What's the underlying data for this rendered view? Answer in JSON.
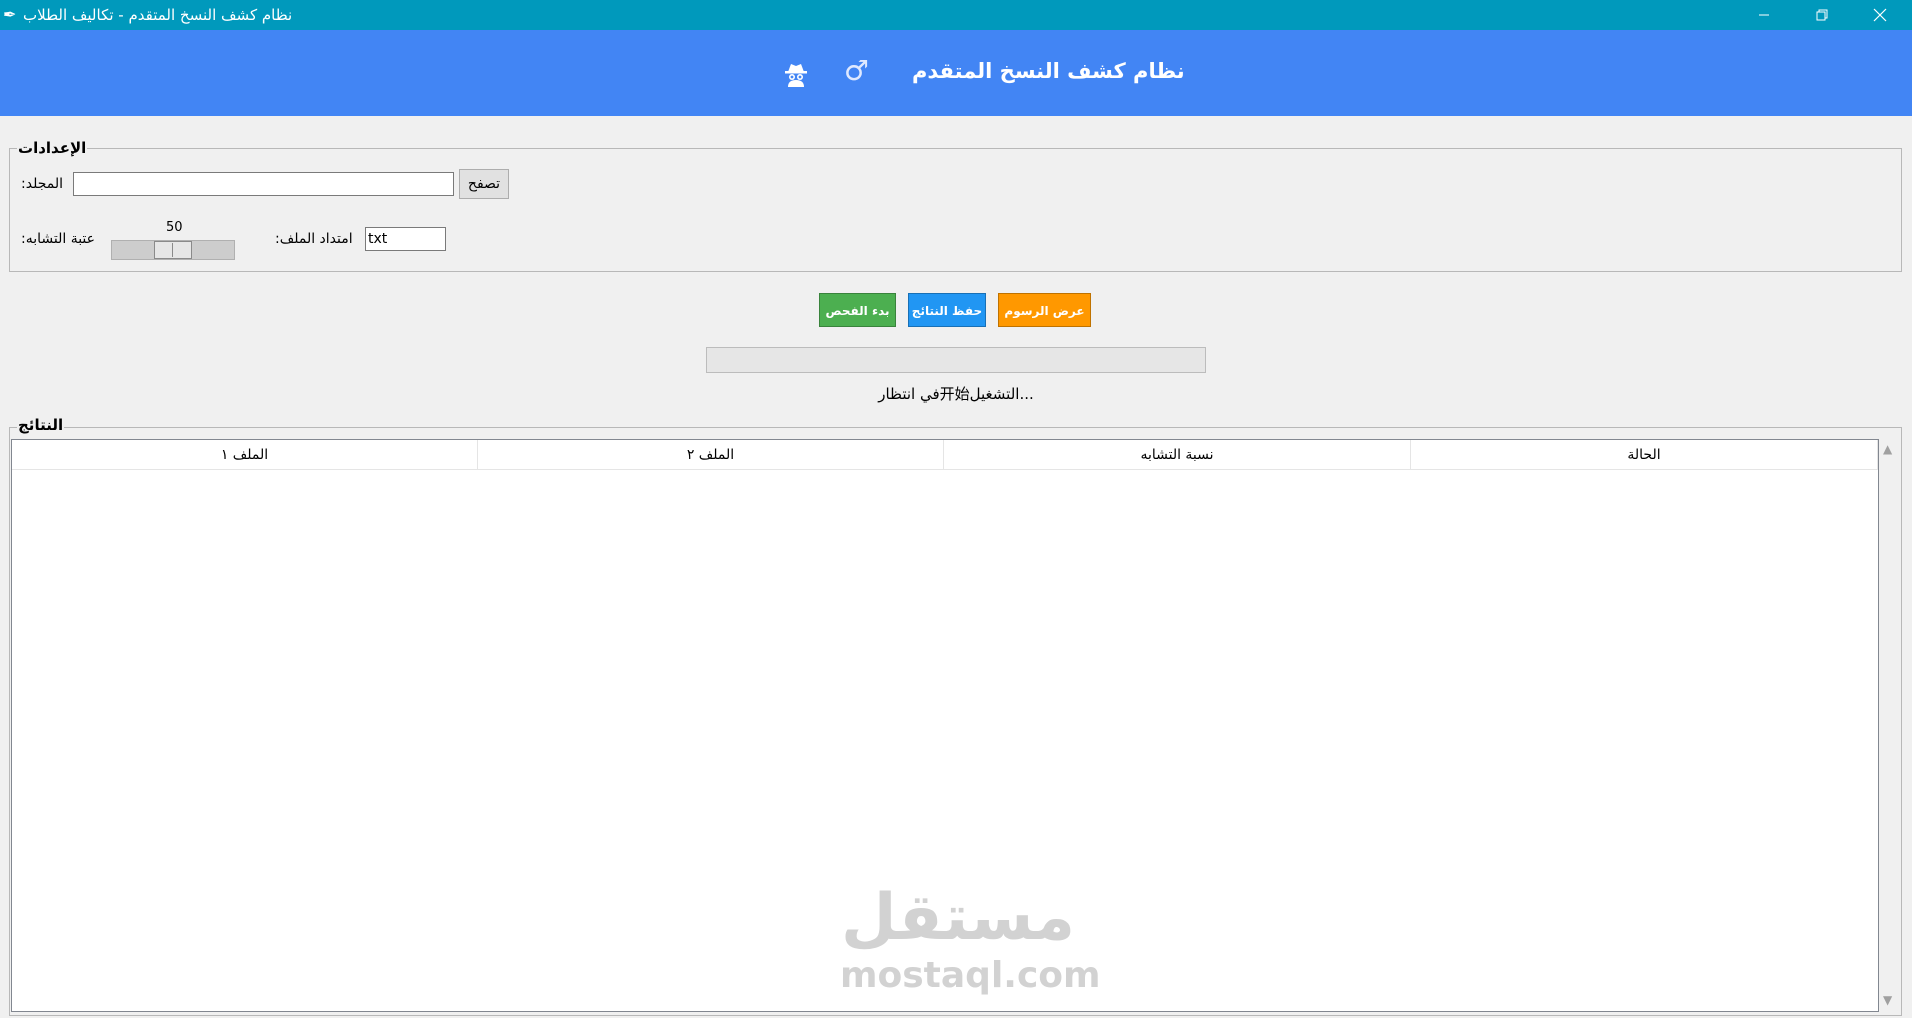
{
  "window": {
    "title": "نظام كشف النسخ المتقدم - تكاليف الطلاب",
    "icon": "feather-icon",
    "controls": [
      "minimize-icon",
      "restore-icon",
      "close-icon"
    ]
  },
  "header": {
    "title": "نظام كشف النسخ المتقدم",
    "male_symbol": "♂",
    "background": "#4285f4"
  },
  "settings": {
    "title": "الإعدادات",
    "folder_label": ":المجلد",
    "folder_value": "",
    "browse_label": "تصفح",
    "threshold_label": ":عتبة التشابه",
    "threshold_value": "50",
    "threshold_min": 0,
    "threshold_max": 100,
    "extension_label": ":امتداد الملف",
    "extension_value": "txt"
  },
  "actions": {
    "start_label": "بدء الفحص",
    "start_color": "#4caf50",
    "save_label": "حفظ النتائج",
    "save_color": "#2196f3",
    "charts_label": "عرض الرسوم",
    "charts_color": "#ff9800"
  },
  "progress": {
    "value": 0
  },
  "status": {
    "text": "في انتظار开始التشغيل..."
  },
  "results": {
    "title": "النتائج",
    "columns": [
      "الملف ١",
      "الملف ٢",
      "نسبة التشابه",
      "الحالة"
    ],
    "rows": []
  },
  "watermark": {
    "logo_text": "مستقل",
    "url_text": "mostaql.com"
  }
}
